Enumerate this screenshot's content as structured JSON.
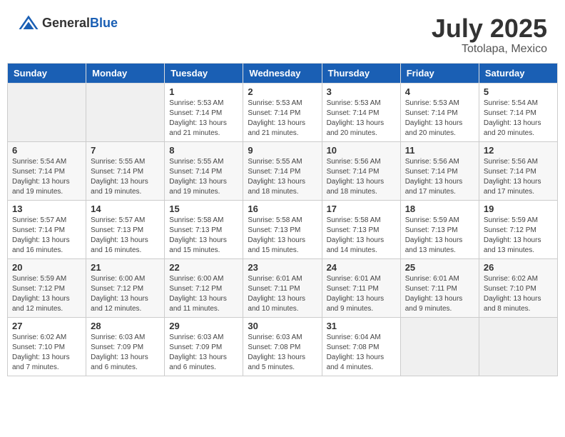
{
  "header": {
    "logo_general": "General",
    "logo_blue": "Blue",
    "title": "July 2025",
    "subtitle": "Totolapa, Mexico"
  },
  "days_of_week": [
    "Sunday",
    "Monday",
    "Tuesday",
    "Wednesday",
    "Thursday",
    "Friday",
    "Saturday"
  ],
  "weeks": [
    [
      {
        "day": "",
        "info": ""
      },
      {
        "day": "",
        "info": ""
      },
      {
        "day": "1",
        "info": "Sunrise: 5:53 AM\nSunset: 7:14 PM\nDaylight: 13 hours and 21 minutes."
      },
      {
        "day": "2",
        "info": "Sunrise: 5:53 AM\nSunset: 7:14 PM\nDaylight: 13 hours and 21 minutes."
      },
      {
        "day": "3",
        "info": "Sunrise: 5:53 AM\nSunset: 7:14 PM\nDaylight: 13 hours and 20 minutes."
      },
      {
        "day": "4",
        "info": "Sunrise: 5:53 AM\nSunset: 7:14 PM\nDaylight: 13 hours and 20 minutes."
      },
      {
        "day": "5",
        "info": "Sunrise: 5:54 AM\nSunset: 7:14 PM\nDaylight: 13 hours and 20 minutes."
      }
    ],
    [
      {
        "day": "6",
        "info": "Sunrise: 5:54 AM\nSunset: 7:14 PM\nDaylight: 13 hours and 19 minutes."
      },
      {
        "day": "7",
        "info": "Sunrise: 5:55 AM\nSunset: 7:14 PM\nDaylight: 13 hours and 19 minutes."
      },
      {
        "day": "8",
        "info": "Sunrise: 5:55 AM\nSunset: 7:14 PM\nDaylight: 13 hours and 19 minutes."
      },
      {
        "day": "9",
        "info": "Sunrise: 5:55 AM\nSunset: 7:14 PM\nDaylight: 13 hours and 18 minutes."
      },
      {
        "day": "10",
        "info": "Sunrise: 5:56 AM\nSunset: 7:14 PM\nDaylight: 13 hours and 18 minutes."
      },
      {
        "day": "11",
        "info": "Sunrise: 5:56 AM\nSunset: 7:14 PM\nDaylight: 13 hours and 17 minutes."
      },
      {
        "day": "12",
        "info": "Sunrise: 5:56 AM\nSunset: 7:14 PM\nDaylight: 13 hours and 17 minutes."
      }
    ],
    [
      {
        "day": "13",
        "info": "Sunrise: 5:57 AM\nSunset: 7:14 PM\nDaylight: 13 hours and 16 minutes."
      },
      {
        "day": "14",
        "info": "Sunrise: 5:57 AM\nSunset: 7:13 PM\nDaylight: 13 hours and 16 minutes."
      },
      {
        "day": "15",
        "info": "Sunrise: 5:58 AM\nSunset: 7:13 PM\nDaylight: 13 hours and 15 minutes."
      },
      {
        "day": "16",
        "info": "Sunrise: 5:58 AM\nSunset: 7:13 PM\nDaylight: 13 hours and 15 minutes."
      },
      {
        "day": "17",
        "info": "Sunrise: 5:58 AM\nSunset: 7:13 PM\nDaylight: 13 hours and 14 minutes."
      },
      {
        "day": "18",
        "info": "Sunrise: 5:59 AM\nSunset: 7:13 PM\nDaylight: 13 hours and 13 minutes."
      },
      {
        "day": "19",
        "info": "Sunrise: 5:59 AM\nSunset: 7:12 PM\nDaylight: 13 hours and 13 minutes."
      }
    ],
    [
      {
        "day": "20",
        "info": "Sunrise: 5:59 AM\nSunset: 7:12 PM\nDaylight: 13 hours and 12 minutes."
      },
      {
        "day": "21",
        "info": "Sunrise: 6:00 AM\nSunset: 7:12 PM\nDaylight: 13 hours and 12 minutes."
      },
      {
        "day": "22",
        "info": "Sunrise: 6:00 AM\nSunset: 7:12 PM\nDaylight: 13 hours and 11 minutes."
      },
      {
        "day": "23",
        "info": "Sunrise: 6:01 AM\nSunset: 7:11 PM\nDaylight: 13 hours and 10 minutes."
      },
      {
        "day": "24",
        "info": "Sunrise: 6:01 AM\nSunset: 7:11 PM\nDaylight: 13 hours and 9 minutes."
      },
      {
        "day": "25",
        "info": "Sunrise: 6:01 AM\nSunset: 7:11 PM\nDaylight: 13 hours and 9 minutes."
      },
      {
        "day": "26",
        "info": "Sunrise: 6:02 AM\nSunset: 7:10 PM\nDaylight: 13 hours and 8 minutes."
      }
    ],
    [
      {
        "day": "27",
        "info": "Sunrise: 6:02 AM\nSunset: 7:10 PM\nDaylight: 13 hours and 7 minutes."
      },
      {
        "day": "28",
        "info": "Sunrise: 6:03 AM\nSunset: 7:09 PM\nDaylight: 13 hours and 6 minutes."
      },
      {
        "day": "29",
        "info": "Sunrise: 6:03 AM\nSunset: 7:09 PM\nDaylight: 13 hours and 6 minutes."
      },
      {
        "day": "30",
        "info": "Sunrise: 6:03 AM\nSunset: 7:08 PM\nDaylight: 13 hours and 5 minutes."
      },
      {
        "day": "31",
        "info": "Sunrise: 6:04 AM\nSunset: 7:08 PM\nDaylight: 13 hours and 4 minutes."
      },
      {
        "day": "",
        "info": ""
      },
      {
        "day": "",
        "info": ""
      }
    ]
  ]
}
